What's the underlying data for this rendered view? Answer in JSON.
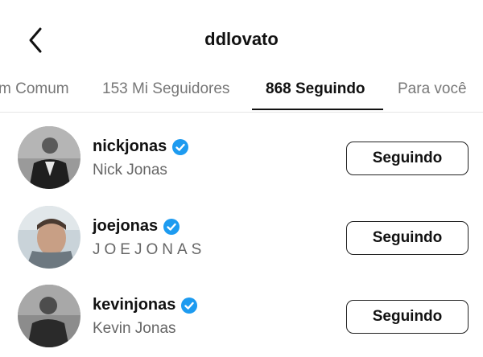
{
  "header": {
    "title": "ddlovato",
    "back_icon": "chevron-left-icon"
  },
  "tabs": [
    {
      "label": "m Comum",
      "active": false
    },
    {
      "label": "153 Mi Seguidores",
      "active": false
    },
    {
      "label": "868 Seguindo",
      "active": true
    },
    {
      "label": "Para você",
      "active": false
    }
  ],
  "users": [
    {
      "username": "nickjonas",
      "full_name": "Nick Jonas",
      "verified": true,
      "button_label": "Seguindo"
    },
    {
      "username": "joejonas",
      "full_name": "JOEJONAS",
      "verified": true,
      "button_label": "Seguindo"
    },
    {
      "username": "kevinjonas",
      "full_name": "Kevin Jonas",
      "verified": true,
      "button_label": "Seguindo"
    }
  ],
  "colors": {
    "verified_badge": "#1d9bf0",
    "active_tab": "#111111",
    "inactive_tab": "#777777"
  }
}
